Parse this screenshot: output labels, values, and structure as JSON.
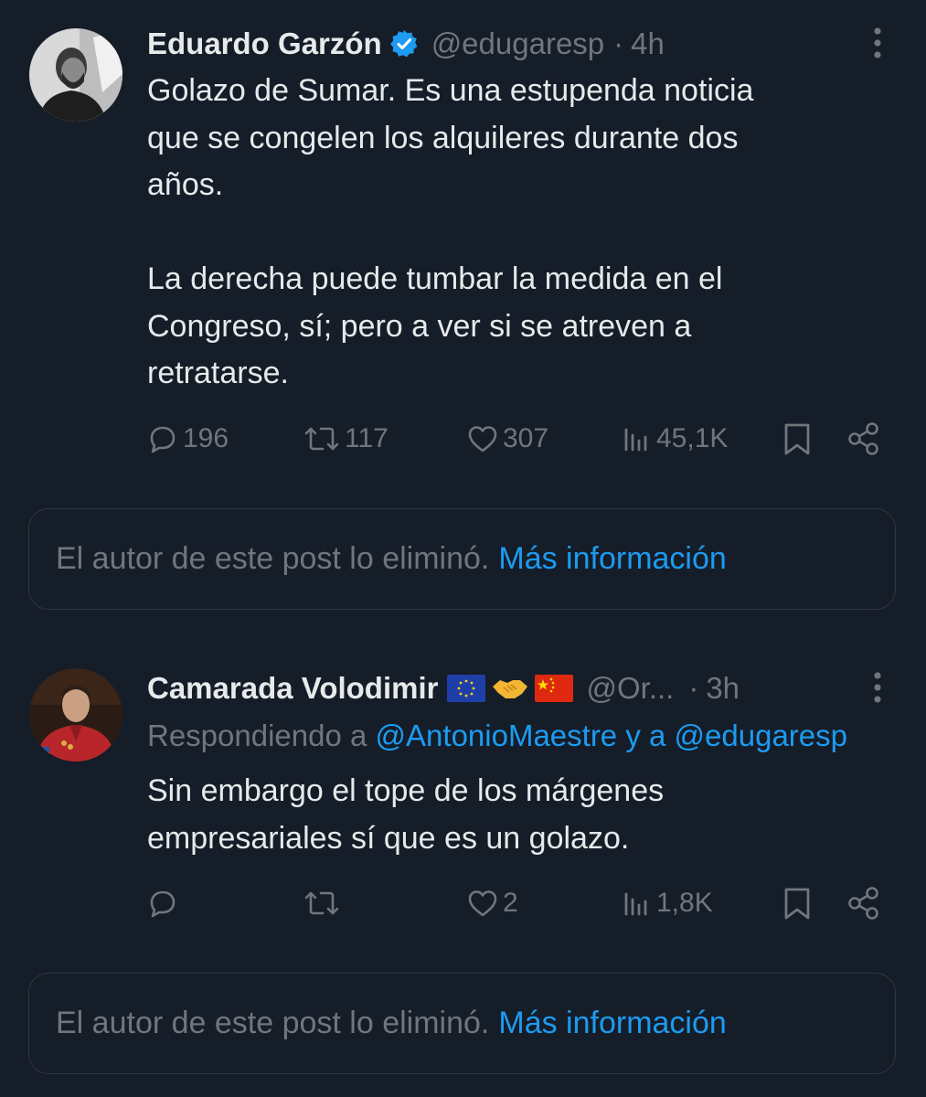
{
  "tweet1": {
    "display_name": "Eduardo Garzón",
    "handle": "@edugaresp",
    "separator": "·",
    "time": "4h",
    "text": "Golazo de Sumar. Es una estupenda noticia\nque se congelen los alquileres durante dos\naños.\n\nLa derecha puede tumbar la medida en el\nCongreso, sí; pero a ver si se atreven a\nretratarse.",
    "replies": "196",
    "retweets": "117",
    "likes": "307",
    "views": "45,1K"
  },
  "deleted_notice_1": {
    "text": "El autor de este post lo eliminó.",
    "link": "Más información"
  },
  "tweet2": {
    "display_name": "Camarada Volodimir",
    "handle": "@Or...",
    "separator": "·",
    "time": "3h",
    "reply_prefix": "Respondiendo a ",
    "reply_user_1": "@AntonioMaestre",
    "reply_conj": " y a ",
    "reply_user_2": "@edugaresp",
    "text": "Sin embargo el tope de los márgenes\nempresariales sí que es un golazo.",
    "replies": "",
    "retweets": "",
    "likes": "2",
    "views": "1,8K"
  },
  "deleted_notice_2": {
    "text": "El autor de este post lo eliminó.",
    "link": "Más información"
  },
  "colors": {
    "background": "#151d29",
    "text": "#e7e9ea",
    "muted": "#71767b",
    "accent": "#1d9bf0",
    "border": "#2f3742"
  },
  "icons": {
    "flags": [
      "eu-flag-icon",
      "handshake-icon",
      "china-flag-icon"
    ],
    "verified": "verified-badge-icon"
  }
}
